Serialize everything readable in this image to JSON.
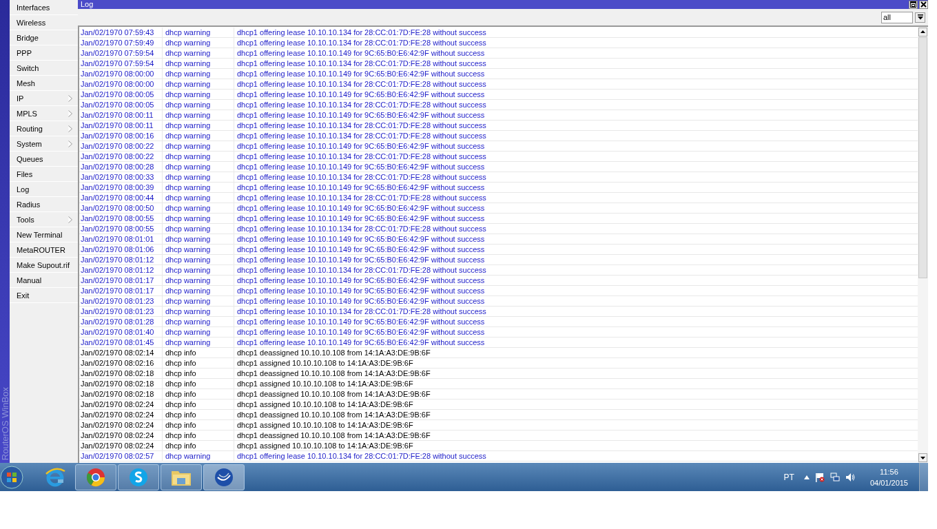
{
  "sidebar": {
    "brand": "RouterOS WinBox",
    "items": [
      {
        "label": "Interfaces",
        "submenu": false
      },
      {
        "label": "Wireless",
        "submenu": false
      },
      {
        "label": "Bridge",
        "submenu": false
      },
      {
        "label": "PPP",
        "submenu": false
      },
      {
        "label": "Switch",
        "submenu": false
      },
      {
        "label": "Mesh",
        "submenu": false
      },
      {
        "label": "IP",
        "submenu": true
      },
      {
        "label": "MPLS",
        "submenu": true
      },
      {
        "label": "Routing",
        "submenu": true
      },
      {
        "label": "System",
        "submenu": true
      },
      {
        "label": "Queues",
        "submenu": false
      },
      {
        "label": "Files",
        "submenu": false
      },
      {
        "label": "Log",
        "submenu": false
      },
      {
        "label": "Radius",
        "submenu": false
      },
      {
        "label": "Tools",
        "submenu": true
      },
      {
        "label": "New Terminal",
        "submenu": false
      },
      {
        "label": "MetaROUTER",
        "submenu": false
      },
      {
        "label": "Make Supout.rif",
        "submenu": false
      },
      {
        "label": "Manual",
        "submenu": false
      },
      {
        "label": "Exit",
        "submenu": false
      }
    ]
  },
  "window": {
    "title": "Log",
    "filter": "all"
  },
  "log": {
    "rows": [
      {
        "time": "Jan/02/1970 07:59:43",
        "topic": "dhcp warning",
        "message": "dhcp1 offering lease 10.10.10.134 for 28:CC:01:7D:FE:28 without success",
        "kind": "warning"
      },
      {
        "time": "Jan/02/1970 07:59:49",
        "topic": "dhcp warning",
        "message": "dhcp1 offering lease 10.10.10.134 for 28:CC:01:7D:FE:28 without success",
        "kind": "warning"
      },
      {
        "time": "Jan/02/1970 07:59:54",
        "topic": "dhcp warning",
        "message": "dhcp1 offering lease 10.10.10.149 for 9C:65:B0:E6:42:9F without success",
        "kind": "warning"
      },
      {
        "time": "Jan/02/1970 07:59:54",
        "topic": "dhcp warning",
        "message": "dhcp1 offering lease 10.10.10.134 for 28:CC:01:7D:FE:28 without success",
        "kind": "warning"
      },
      {
        "time": "Jan/02/1970 08:00:00",
        "topic": "dhcp warning",
        "message": "dhcp1 offering lease 10.10.10.149 for 9C:65:B0:E6:42:9F without success",
        "kind": "warning"
      },
      {
        "time": "Jan/02/1970 08:00:00",
        "topic": "dhcp warning",
        "message": "dhcp1 offering lease 10.10.10.134 for 28:CC:01:7D:FE:28 without success",
        "kind": "warning"
      },
      {
        "time": "Jan/02/1970 08:00:05",
        "topic": "dhcp warning",
        "message": "dhcp1 offering lease 10.10.10.149 for 9C:65:B0:E6:42:9F without success",
        "kind": "warning"
      },
      {
        "time": "Jan/02/1970 08:00:05",
        "topic": "dhcp warning",
        "message": "dhcp1 offering lease 10.10.10.134 for 28:CC:01:7D:FE:28 without success",
        "kind": "warning"
      },
      {
        "time": "Jan/02/1970 08:00:11",
        "topic": "dhcp warning",
        "message": "dhcp1 offering lease 10.10.10.149 for 9C:65:B0:E6:42:9F without success",
        "kind": "warning"
      },
      {
        "time": "Jan/02/1970 08:00:11",
        "topic": "dhcp warning",
        "message": "dhcp1 offering lease 10.10.10.134 for 28:CC:01:7D:FE:28 without success",
        "kind": "warning"
      },
      {
        "time": "Jan/02/1970 08:00:16",
        "topic": "dhcp warning",
        "message": "dhcp1 offering lease 10.10.10.134 for 28:CC:01:7D:FE:28 without success",
        "kind": "warning"
      },
      {
        "time": "Jan/02/1970 08:00:22",
        "topic": "dhcp warning",
        "message": "dhcp1 offering lease 10.10.10.149 for 9C:65:B0:E6:42:9F without success",
        "kind": "warning"
      },
      {
        "time": "Jan/02/1970 08:00:22",
        "topic": "dhcp warning",
        "message": "dhcp1 offering lease 10.10.10.134 for 28:CC:01:7D:FE:28 without success",
        "kind": "warning"
      },
      {
        "time": "Jan/02/1970 08:00:28",
        "topic": "dhcp warning",
        "message": "dhcp1 offering lease 10.10.10.149 for 9C:65:B0:E6:42:9F without success",
        "kind": "warning"
      },
      {
        "time": "Jan/02/1970 08:00:33",
        "topic": "dhcp warning",
        "message": "dhcp1 offering lease 10.10.10.134 for 28:CC:01:7D:FE:28 without success",
        "kind": "warning"
      },
      {
        "time": "Jan/02/1970 08:00:39",
        "topic": "dhcp warning",
        "message": "dhcp1 offering lease 10.10.10.149 for 9C:65:B0:E6:42:9F without success",
        "kind": "warning"
      },
      {
        "time": "Jan/02/1970 08:00:44",
        "topic": "dhcp warning",
        "message": "dhcp1 offering lease 10.10.10.134 for 28:CC:01:7D:FE:28 without success",
        "kind": "warning"
      },
      {
        "time": "Jan/02/1970 08:00:50",
        "topic": "dhcp warning",
        "message": "dhcp1 offering lease 10.10.10.149 for 9C:65:B0:E6:42:9F without success",
        "kind": "warning"
      },
      {
        "time": "Jan/02/1970 08:00:55",
        "topic": "dhcp warning",
        "message": "dhcp1 offering lease 10.10.10.149 for 9C:65:B0:E6:42:9F without success",
        "kind": "warning"
      },
      {
        "time": "Jan/02/1970 08:00:55",
        "topic": "dhcp warning",
        "message": "dhcp1 offering lease 10.10.10.134 for 28:CC:01:7D:FE:28 without success",
        "kind": "warning"
      },
      {
        "time": "Jan/02/1970 08:01:01",
        "topic": "dhcp warning",
        "message": "dhcp1 offering lease 10.10.10.149 for 9C:65:B0:E6:42:9F without success",
        "kind": "warning"
      },
      {
        "time": "Jan/02/1970 08:01:06",
        "topic": "dhcp warning",
        "message": "dhcp1 offering lease 10.10.10.149 for 9C:65:B0:E6:42:9F without success",
        "kind": "warning"
      },
      {
        "time": "Jan/02/1970 08:01:12",
        "topic": "dhcp warning",
        "message": "dhcp1 offering lease 10.10.10.149 for 9C:65:B0:E6:42:9F without success",
        "kind": "warning"
      },
      {
        "time": "Jan/02/1970 08:01:12",
        "topic": "dhcp warning",
        "message": "dhcp1 offering lease 10.10.10.134 for 28:CC:01:7D:FE:28 without success",
        "kind": "warning"
      },
      {
        "time": "Jan/02/1970 08:01:17",
        "topic": "dhcp warning",
        "message": "dhcp1 offering lease 10.10.10.149 for 9C:65:B0:E6:42:9F without success",
        "kind": "warning"
      },
      {
        "time": "Jan/02/1970 08:01:17",
        "topic": "dhcp warning",
        "message": "dhcp1 offering lease 10.10.10.149 for 9C:65:B0:E6:42:9F without success",
        "kind": "warning"
      },
      {
        "time": "Jan/02/1970 08:01:23",
        "topic": "dhcp warning",
        "message": "dhcp1 offering lease 10.10.10.149 for 9C:65:B0:E6:42:9F without success",
        "kind": "warning"
      },
      {
        "time": "Jan/02/1970 08:01:23",
        "topic": "dhcp warning",
        "message": "dhcp1 offering lease 10.10.10.134 for 28:CC:01:7D:FE:28 without success",
        "kind": "warning"
      },
      {
        "time": "Jan/02/1970 08:01:28",
        "topic": "dhcp warning",
        "message": "dhcp1 offering lease 10.10.10.149 for 9C:65:B0:E6:42:9F without success",
        "kind": "warning"
      },
      {
        "time": "Jan/02/1970 08:01:40",
        "topic": "dhcp warning",
        "message": "dhcp1 offering lease 10.10.10.149 for 9C:65:B0:E6:42:9F without success",
        "kind": "warning"
      },
      {
        "time": "Jan/02/1970 08:01:45",
        "topic": "dhcp warning",
        "message": "dhcp1 offering lease 10.10.10.149 for 9C:65:B0:E6:42:9F without success",
        "kind": "warning"
      },
      {
        "time": "Jan/02/1970 08:02:14",
        "topic": "dhcp info",
        "message": "dhcp1 deassigned 10.10.10.108 from 14:1A:A3:DE:9B:6F",
        "kind": "info"
      },
      {
        "time": "Jan/02/1970 08:02:16",
        "topic": "dhcp info",
        "message": "dhcp1 assigned 10.10.10.108 to 14:1A:A3:DE:9B:6F",
        "kind": "info"
      },
      {
        "time": "Jan/02/1970 08:02:18",
        "topic": "dhcp info",
        "message": "dhcp1 deassigned 10.10.10.108 from 14:1A:A3:DE:9B:6F",
        "kind": "info"
      },
      {
        "time": "Jan/02/1970 08:02:18",
        "topic": "dhcp info",
        "message": "dhcp1 assigned 10.10.10.108 to 14:1A:A3:DE:9B:6F",
        "kind": "info"
      },
      {
        "time": "Jan/02/1970 08:02:18",
        "topic": "dhcp info",
        "message": "dhcp1 deassigned 10.10.10.108 from 14:1A:A3:DE:9B:6F",
        "kind": "info"
      },
      {
        "time": "Jan/02/1970 08:02:24",
        "topic": "dhcp info",
        "message": "dhcp1 assigned 10.10.10.108 to 14:1A:A3:DE:9B:6F",
        "kind": "info"
      },
      {
        "time": "Jan/02/1970 08:02:24",
        "topic": "dhcp info",
        "message": "dhcp1 deassigned 10.10.10.108 from 14:1A:A3:DE:9B:6F",
        "kind": "info"
      },
      {
        "time": "Jan/02/1970 08:02:24",
        "topic": "dhcp info",
        "message": "dhcp1 assigned 10.10.10.108 to 14:1A:A3:DE:9B:6F",
        "kind": "info"
      },
      {
        "time": "Jan/02/1970 08:02:24",
        "topic": "dhcp info",
        "message": "dhcp1 deassigned 10.10.10.108 from 14:1A:A3:DE:9B:6F",
        "kind": "info"
      },
      {
        "time": "Jan/02/1970 08:02:24",
        "topic": "dhcp info",
        "message": "dhcp1 assigned 10.10.10.108 to 14:1A:A3:DE:9B:6F",
        "kind": "info"
      },
      {
        "time": "Jan/02/1970 08:02:57",
        "topic": "dhcp warning",
        "message": "dhcp1 offering lease 10.10.10.134 for 28:CC:01:7D:FE:28 without success",
        "kind": "warning"
      }
    ]
  },
  "taskbar": {
    "language": "PT",
    "time": "11:56",
    "date": "04/01/2015"
  }
}
